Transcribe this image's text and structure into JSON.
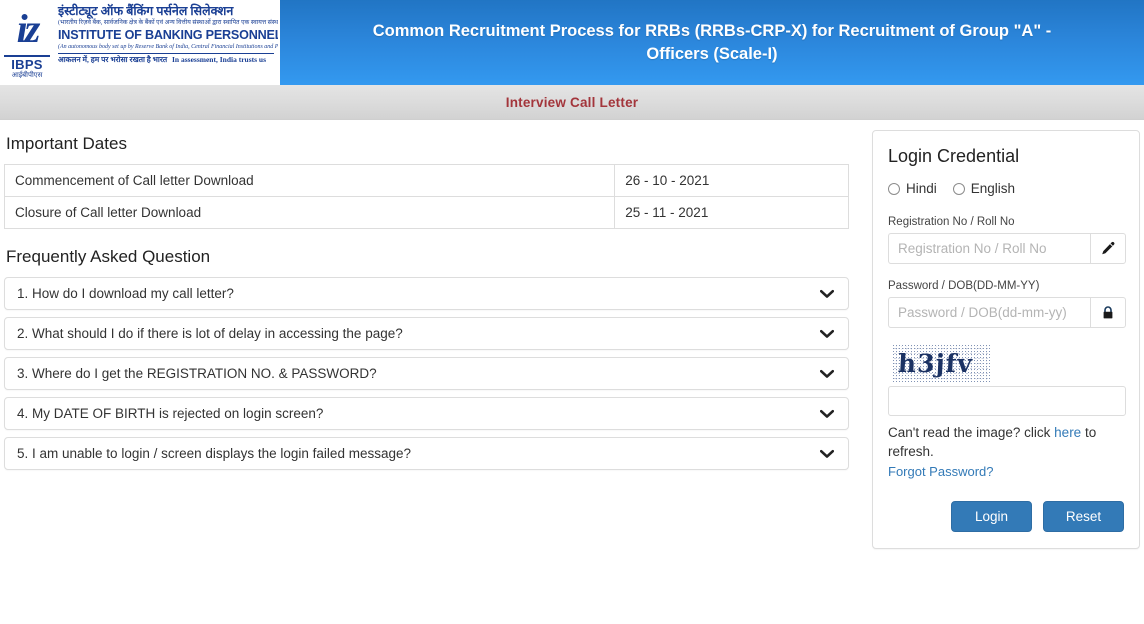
{
  "header": {
    "logo": {
      "mark_initials": "iz",
      "mark_abbr": "IBPS",
      "mark_abbr_hindi": "आईबीपीएस",
      "name_hindi": "इंस्टीट्यूट ऑफ बैंकिंग पर्सनेल सिलेक्शन",
      "subtitle_hindi": "(भारतीय रिज़र्व बैंक, सार्वजनिक क्षेत्र के बैंकों एवं अन्य वित्तीय संस्थाओं द्वारा स्थापित एक स्वायत्त संस्था)",
      "name_english": "INSTITUTE OF BANKING PERSONNEL SELECTION",
      "subtitle_english": "(An autonomous body set up by Reserve Bank of India, Central Financial Institutions and Public Sector Banks)",
      "tagline_hindi": "आकलन में, हम पर भरोसा रखता है भारत",
      "tagline_english": "In assessment, India trusts us"
    },
    "title": "Common Recruitment Process for RRBs (RRBs-CRP-X) for Recruitment of Group \"A\" - Officers (Scale-I)",
    "subbar_title": "Interview Call Letter",
    "banner_gradient_from": "#2175c4",
    "banner_gradient_to": "#3399f0",
    "subbar_text_color": "#a3353b"
  },
  "important_dates": {
    "heading": "Important Dates",
    "rows": [
      {
        "label": "Commencement of Call letter Download",
        "date": "26 - 10 - 2021"
      },
      {
        "label": "Closure of Call letter Download",
        "date": "25 - 11 - 2021"
      }
    ]
  },
  "faq": {
    "heading": "Frequently Asked Question",
    "items": [
      {
        "question": "1. How do I download my call letter?"
      },
      {
        "question": "2. What should I do if there is lot of delay in accessing the page?"
      },
      {
        "question": "3. Where do I get the REGISTRATION NO. & PASSWORD?"
      },
      {
        "question": "4. My DATE OF BIRTH is rejected on login screen?"
      },
      {
        "question": "5. I am unable to login / screen displays the login failed message?"
      }
    ]
  },
  "login": {
    "heading": "Login Credential",
    "language_options": [
      {
        "label": "Hindi",
        "selected": false
      },
      {
        "label": "English",
        "selected": false
      }
    ],
    "registration": {
      "label": "Registration No / Roll No",
      "placeholder": "Registration No / Roll No",
      "value": "",
      "addon_icon": "pencil-icon"
    },
    "password": {
      "label": "Password / DOB(DD-MM-YY)",
      "placeholder": "Password / DOB(dd-mm-yy)",
      "value": "",
      "addon_icon": "lock-icon"
    },
    "captcha": {
      "text": "h3jfv",
      "input_value": "",
      "input_placeholder": "",
      "refresh_prefix": "Can't read the image? click ",
      "refresh_link": "here",
      "refresh_suffix": " to refresh.",
      "text_color": "#1b3263"
    },
    "forgot_password": "Forgot Password?",
    "buttons": {
      "login": "Login",
      "reset": "Reset"
    },
    "accent_color": "#337ab7",
    "link_color": "#337ab7"
  }
}
